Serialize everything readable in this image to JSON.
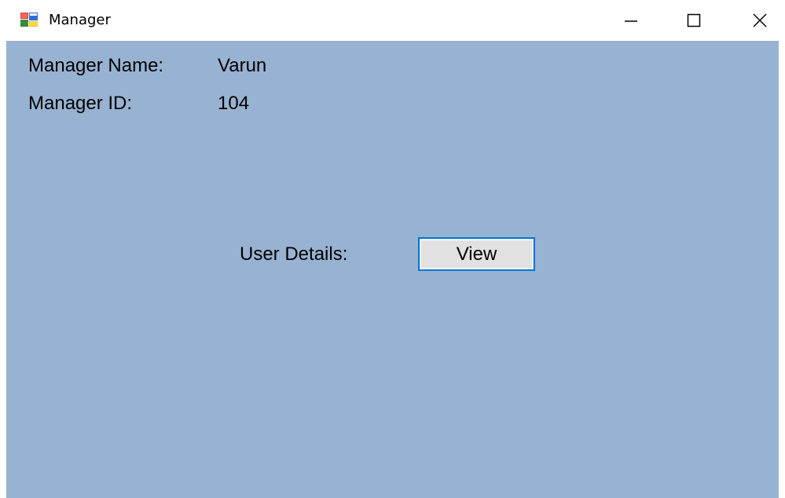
{
  "window": {
    "title": "Manager",
    "app_icon": "winforms-app-icon",
    "controls": {
      "minimize_icon": "minimize-icon",
      "maximize_icon": "maximize-icon",
      "close_icon": "close-icon"
    }
  },
  "form": {
    "background_color": "#98b2d1",
    "manager_name_label": "Manager Name:",
    "manager_name_value": "Varun",
    "manager_id_label": "Manager ID:",
    "manager_id_value": "104",
    "user_details_label": "User Details:",
    "view_button_label": "View",
    "accent_color": "#0078d7"
  }
}
